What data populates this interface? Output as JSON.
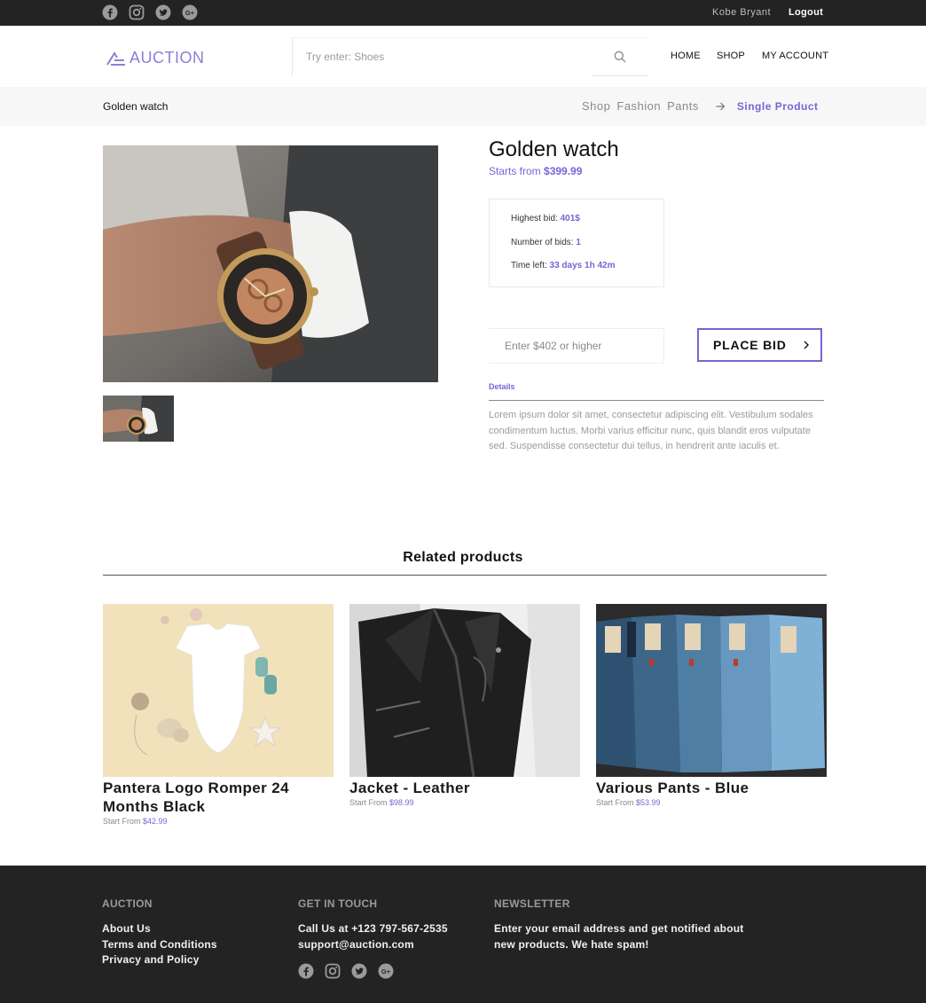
{
  "topbar": {
    "socials": [
      "facebook-icon",
      "instagram-icon",
      "twitter-icon",
      "google-plus-icon"
    ],
    "user_name": "Kobe Bryant",
    "logout": "Logout"
  },
  "header": {
    "logo_text": "AUCTION",
    "search_placeholder": "Try enter: Shoes",
    "nav": [
      "HOME",
      "SHOP",
      "MY ACCOUNT"
    ]
  },
  "breadcrumb": {
    "page_title": "Golden watch",
    "items": [
      "Shop",
      "Fashion",
      "Pants"
    ],
    "current": "Single Product"
  },
  "product": {
    "title": "Golden watch",
    "starts_from_label": "Starts from",
    "starts_from_price": "$399.99",
    "highest_bid_label": "Highest bid:",
    "highest_bid": "401$",
    "num_bids_label": "Number of bids:",
    "num_bids": "1",
    "time_left_label": "Time left:",
    "time_left": "33 days 1h 42m",
    "bid_placeholder": "Enter $402 or higher",
    "place_bid": "PLACE BID",
    "details_tab": "Details",
    "details_text": "Lorem ipsum dolor sit amet, consectetur adipiscing elit. Vestibulum sodales condimentum luctus. Morbi varius efficitur nunc, quis blandit eros vulputate sed. Suspendisse consectetur dui tellus, in hendrerit ante iaculis et."
  },
  "related": {
    "title": "Related products",
    "items": [
      {
        "name": "Pantera Logo Romper 24 Months Black",
        "price_label": "Start From",
        "price": "$42.99"
      },
      {
        "name": "Jacket - Leather",
        "price_label": "Start From",
        "price": "$98.99"
      },
      {
        "name": "Various Pants - Blue",
        "price_label": "Start From",
        "price": "$53.99"
      }
    ]
  },
  "footer": {
    "col1": {
      "heading": "AUCTION",
      "links": [
        "About Us",
        "Terms and Conditions",
        "Privacy and Policy"
      ]
    },
    "col2": {
      "heading": "GET IN TOUCH",
      "phone": "Call Us at +123 797-567-2535",
      "email": "support@auction.com"
    },
    "col3": {
      "heading": "NEWSLETTER",
      "text": "Enter your email address and get notified about new products. We hate spam!"
    }
  },
  "colors": {
    "accent": "#7a63d6",
    "dark": "#232323",
    "band": "#f7f7f7"
  }
}
